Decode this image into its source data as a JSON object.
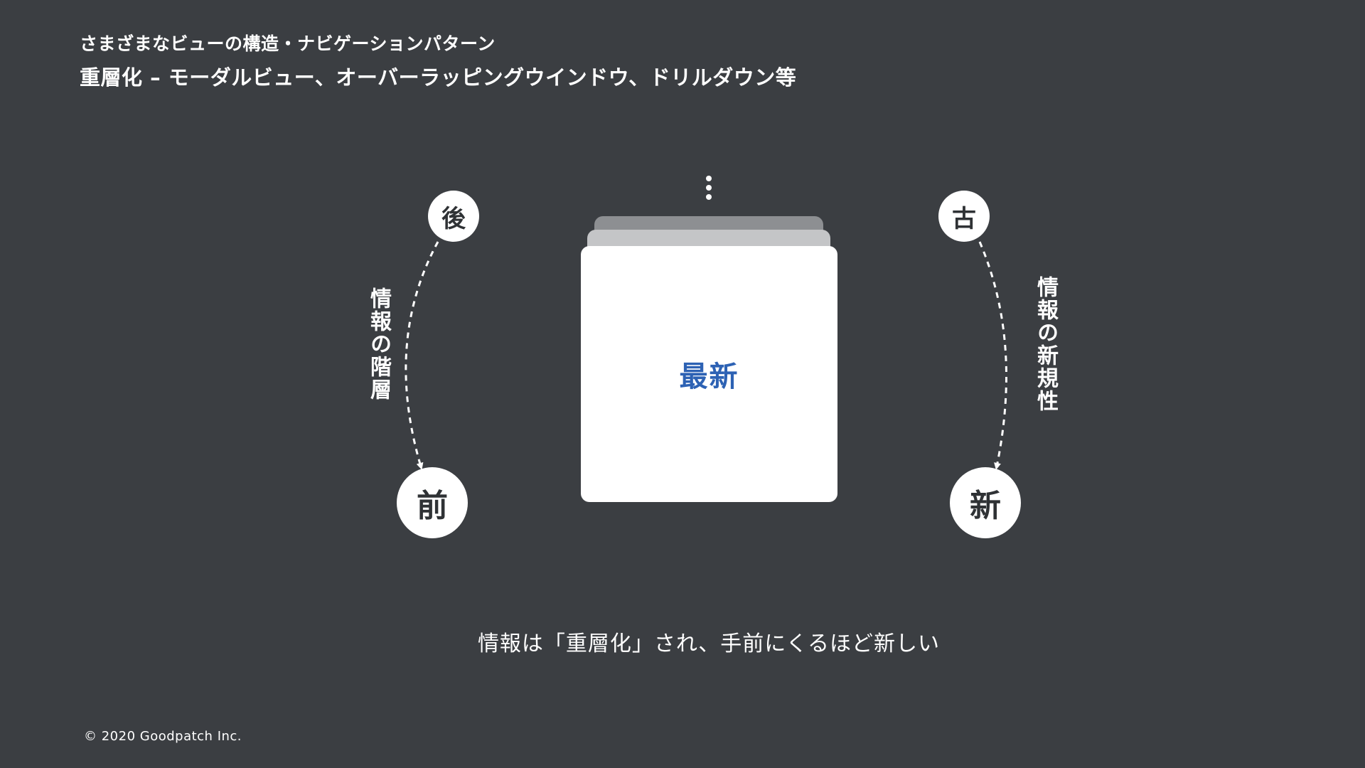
{
  "header": {
    "subtitle": "さまざまなビューの構造・ナビゲーションパターン",
    "title": "重層化 – モーダルビュー、オーバーラッピングウインドウ、ドリルダウン等"
  },
  "diagram": {
    "left": {
      "top_node": "後",
      "bottom_node": "前",
      "axis_label": "情報の階層"
    },
    "right": {
      "top_node": "古",
      "bottom_node": "新",
      "axis_label": "情報の新規性"
    },
    "stack": {
      "front_label": "最新"
    },
    "caption": "情報は「重層化」され、手前にくるほど新しい"
  },
  "footer": {
    "copyright": "© 2020 Goodpatch Inc."
  },
  "colors": {
    "background": "#3b3e42",
    "accent": "#2d62b4",
    "card": "#ffffff"
  }
}
